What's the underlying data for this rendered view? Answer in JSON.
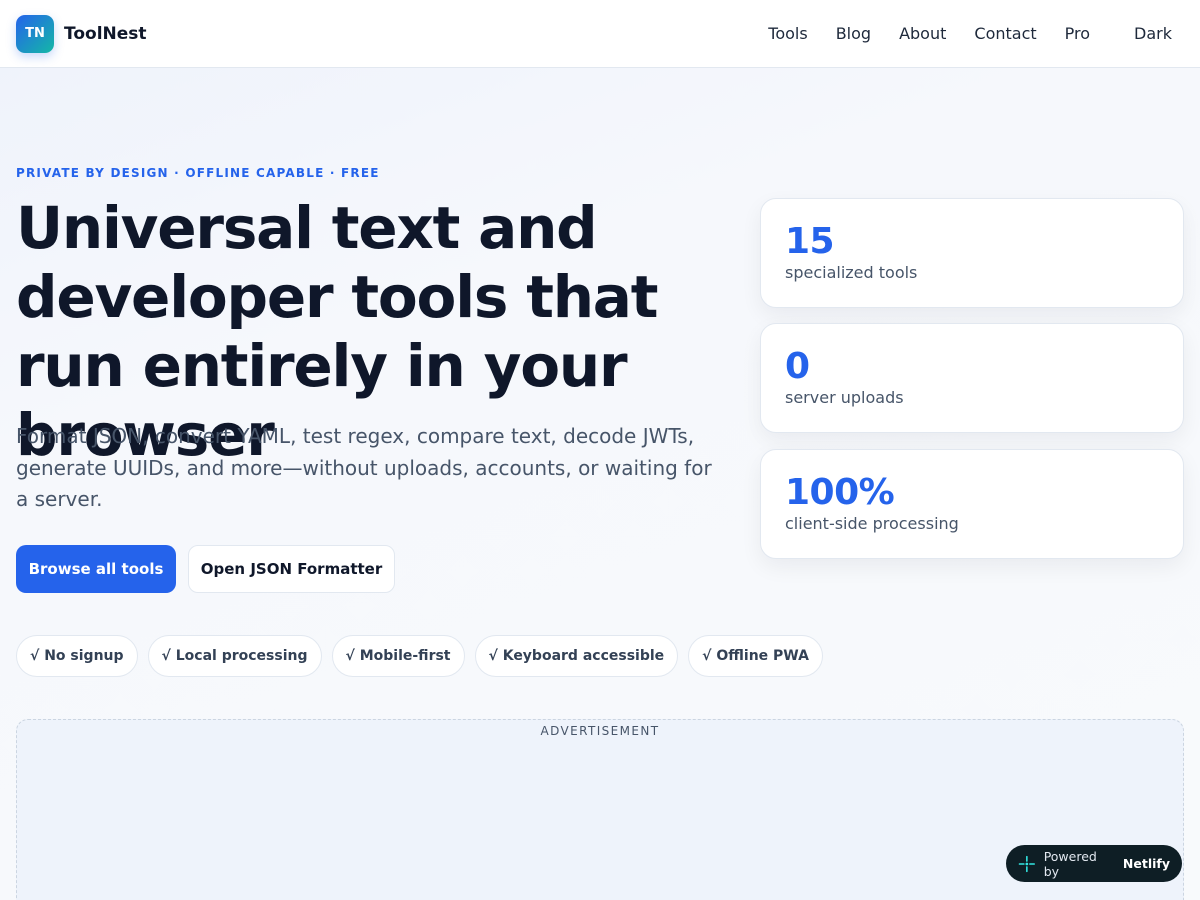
{
  "header": {
    "logo_text": "TN",
    "brand": "ToolNest",
    "nav": [
      "Tools",
      "Blog",
      "About",
      "Contact",
      "Pro"
    ],
    "theme_toggle": "Dark"
  },
  "hero": {
    "eyebrow": "PRIVATE BY DESIGN · OFFLINE CAPABLE · FREE",
    "title": "Universal text and developer tools that run entirely in your browser",
    "subtitle": "Format JSON, convert YAML, test regex, compare text, decode JWTs, generate UUIDs, and more—without uploads, accounts, or waiting for a server.",
    "primary_cta": "Browse all tools",
    "secondary_cta": "Open JSON Formatter",
    "features": [
      "√ No signup",
      "√ Local processing",
      "√ Mobile-first",
      "√ Keyboard accessible",
      "√ Offline PWA"
    ]
  },
  "stats": [
    {
      "value": "15",
      "label": "specialized tools"
    },
    {
      "value": "0",
      "label": "server uploads"
    },
    {
      "value": "100%",
      "label": "client-side processing"
    }
  ],
  "ad": {
    "label": "ADVERTISEMENT"
  },
  "badge": {
    "prefix": "Powered by",
    "brand": "Netlify",
    "icon": "netlify-icon"
  },
  "colors": {
    "accent": "#2563eb",
    "heading": "#0f172a",
    "muted": "#475569",
    "badge_bg": "#0e1e25",
    "logo_gradient_end": "#14b8a6"
  }
}
